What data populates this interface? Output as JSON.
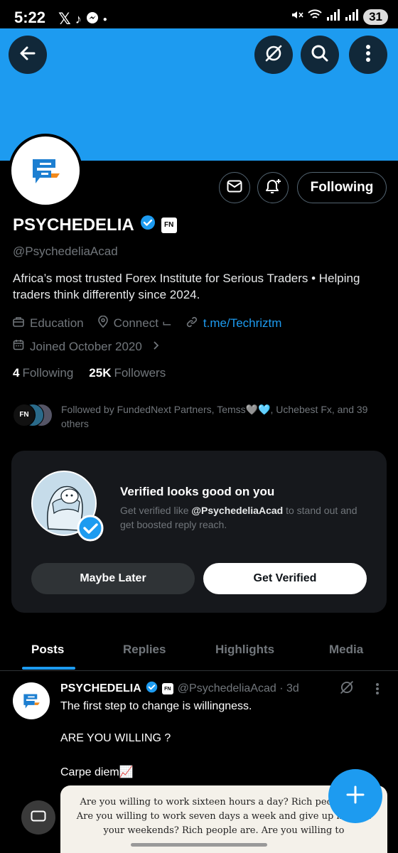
{
  "status_bar": {
    "time": "5:22",
    "battery": "31"
  },
  "profile": {
    "name": "PSYCHEDELIA",
    "badge_text": "FN",
    "handle": "@PsychedeliaAcad",
    "bio": "Africa’s most trusted Forex Institute for Serious Traders • Helping traders think differently since 2024.",
    "category": "Education",
    "location": "Connect ⌙",
    "link": "t.me/Techriztm",
    "joined": "Joined October 2020",
    "following_count": "4",
    "following_label": "Following",
    "followers_count": "25K",
    "followers_label": "Followers",
    "followed_by": "Followed by FundedNext Partners, Temss🩶🩵, Uchebest Fx, and 39 others",
    "follow_button": "Following"
  },
  "verify_card": {
    "title": "Verified looks good on you",
    "sub_prefix": "Get verified like ",
    "sub_handle": "@PsychedeliaAcad",
    "sub_suffix": " to stand out and get boosted reply reach.",
    "later_button": "Maybe Later",
    "verify_button": "Get Verified"
  },
  "tabs": [
    "Posts",
    "Replies",
    "Highlights",
    "Media"
  ],
  "post": {
    "name": "PSYCHEDELIA",
    "badge_text": "FN",
    "handle_time": "@PsychedeliaAcad · 3d",
    "line1": "The first step to change is willingness.",
    "line2": "ARE YOU WILLING ?",
    "line3": "Carpe diem📈",
    "image_text": "Are you willing to work sixteen hours a day? Rich people are. Are you willing to work seven days a week and give up most of your weekends? Rich people are. Are you willing to"
  },
  "colors": {
    "accent": "#1d9bf0",
    "background": "#000000",
    "secondary_text": "#71767b"
  }
}
